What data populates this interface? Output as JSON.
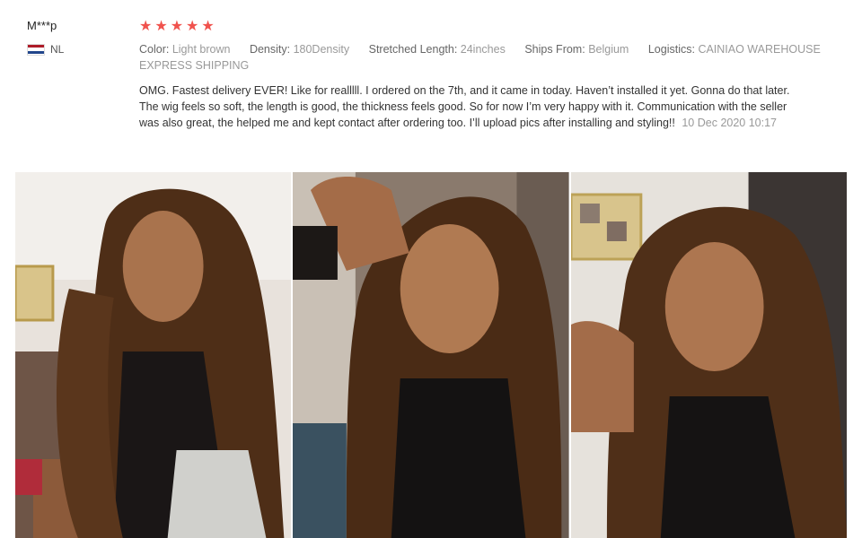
{
  "reviewer": {
    "name": "M***p",
    "country_code": "NL",
    "flag_colors": [
      "#ae1c28",
      "#ffffff",
      "#21468b"
    ]
  },
  "rating": {
    "value": 5,
    "max": 5,
    "star_color": "#f0524d"
  },
  "attributes": [
    {
      "label": "Color:",
      "value": "Light brown"
    },
    {
      "label": "Density:",
      "value": "180Density"
    },
    {
      "label": "Stretched Length:",
      "value": "24inches"
    },
    {
      "label": "Ships From:",
      "value": "Belgium"
    },
    {
      "label": "Logistics:",
      "value": "CAINIAO WAREHOUSE EXPRESS SHIPPING"
    }
  ],
  "review": {
    "text": "OMG. Fastest delivery EVER! Like for realllll. I ordered on the 7th, and it came in today. Haven’t installed it yet. Gonna do that later. The wig feels so soft, the length is good, the thickness feels good. So for now I’m very happy with it. Communication with the seller was also great, the helped me and kept contact after ordering too. I’ll upload pics after installing and styling!!",
    "date": "10 Dec 2020 10:17"
  },
  "photos": [
    {
      "name": "review-photo-1",
      "alt": "Customer photo 1"
    },
    {
      "name": "review-photo-2",
      "alt": "Customer photo 2"
    },
    {
      "name": "review-photo-3",
      "alt": "Customer photo 3"
    }
  ]
}
